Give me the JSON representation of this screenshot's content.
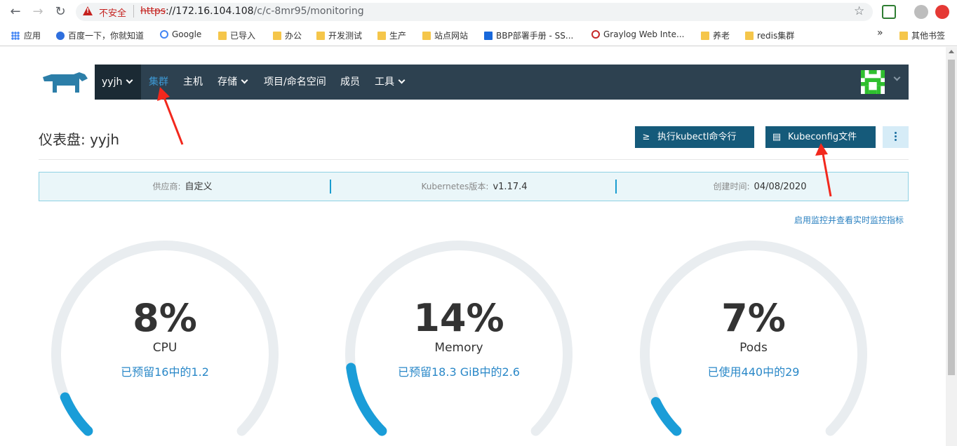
{
  "browser": {
    "insecure_label": "不安全",
    "url_proto": "https",
    "url_host": "://172.16.104.108",
    "url_path": "/c/c-8mr95/monitoring",
    "bookmarks": [
      {
        "label": "应用",
        "icon": "apps-icon"
      },
      {
        "label": "百度一下，你就知道",
        "icon": "baidu-icon"
      },
      {
        "label": "Google",
        "icon": "google-icon"
      },
      {
        "label": "已导入",
        "icon": "folder-icon"
      },
      {
        "label": "办公",
        "icon": "folder-icon"
      },
      {
        "label": "开发测试",
        "icon": "folder-icon"
      },
      {
        "label": "生产",
        "icon": "folder-icon"
      },
      {
        "label": "站点网站",
        "icon": "folder-icon"
      },
      {
        "label": "BBP部署手册 - SS...",
        "icon": "confluence-icon"
      },
      {
        "label": "Graylog Web Inte...",
        "icon": "graylog-icon"
      },
      {
        "label": "养老",
        "icon": "folder-icon"
      },
      {
        "label": "redis集群",
        "icon": "folder-icon"
      }
    ],
    "more_bookmarks": "»",
    "other_bookmarks": "其他书签"
  },
  "header": {
    "cluster_name": "yyjh",
    "nav": [
      "集群",
      "主机",
      "存储",
      "项目/命名空间",
      "成员",
      "工具"
    ],
    "active_nav": "集群"
  },
  "page": {
    "title": "仪表盘: yyjh",
    "kubectl_button": "执行kubectl命令行",
    "kubeconfig_button": "Kubeconfig文件",
    "info": [
      {
        "key": "供应商:",
        "value": "自定义"
      },
      {
        "key": "Kubernetes版本:",
        "value": "v1.17.4"
      },
      {
        "key": "创建时间:",
        "value": "04/08/2020"
      }
    ],
    "monitor_link": "启用监控并查看实时监控指标"
  },
  "gauges": [
    {
      "value": "8%",
      "name": "CPU",
      "sub": "已预留16中的1.2",
      "fraction": 0.08
    },
    {
      "value": "14%",
      "name": "Memory",
      "sub": "已预留18.3 GiB中的2.6",
      "fraction": 0.14
    },
    {
      "value": "7%",
      "name": "Pods",
      "sub": "已使用440中的29",
      "fraction": 0.07
    }
  ],
  "colors": {
    "header_bg": "#2d4150",
    "active_nav": "#3d98d3",
    "primary_button": "#155a7a",
    "gauge_track": "#e9edf0",
    "gauge_fill": "#1a9dd8",
    "annotation_arrow": "#f2281d"
  }
}
